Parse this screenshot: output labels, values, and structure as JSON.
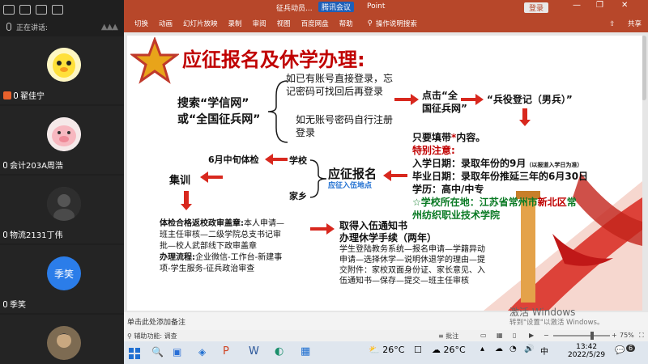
{
  "sidebar": {
    "speaking_label": "正在讲话:",
    "participants": [
      {
        "name": "翟佳宁",
        "avatar_type": "duck"
      },
      {
        "name": "会计203A周浩",
        "avatar_type": "pig"
      },
      {
        "name": "物流2131丁伟",
        "avatar_type": "photo"
      },
      {
        "name": "季笑",
        "avatar_text": "季笑"
      },
      {
        "name": "",
        "avatar_type": "photo"
      }
    ]
  },
  "titlebar": {
    "title": "征兵动员...",
    "meeting_label": "腾讯会议",
    "app_suffix": "Point",
    "login_label": "登录"
  },
  "ribbon": {
    "tabs": [
      "切换",
      "动画",
      "幻灯片放映",
      "录制",
      "审阅",
      "视图",
      "百度网盘",
      "帮助"
    ],
    "search_label": "操作说明搜索",
    "share_label": "共享"
  },
  "slide": {
    "title": "应征报名及休学办理:",
    "has_account": "如已有账号直接登录，忘\n记密码可找回后再登录",
    "search_prompt": "搜索“学信网”\n或“全国征兵网”",
    "no_account": "如无账号密码自行注册\n登录",
    "click_site": "点击“全\n国征兵网”",
    "register": "“兵役登记（男兵）”",
    "fill_required_pre": "只要填带",
    "fill_required_star": "*",
    "fill_required_post": "内容。",
    "special_note": "特别注意:",
    "entry_date": "入学日期：录取年份的9月",
    "entry_date_note": "（以报道入学日为准）",
    "grad_date": "毕业日期：录取年份推延三年的6月30日",
    "education": "学历：高中/中专",
    "school_location_pre": "☆学校所在地：江苏省常州市",
    "school_location_hl": "新北区",
    "school_location_post": "常\n州纺织职业技术学院",
    "enlist_signup": "应征报名",
    "enlist_location": "应征入伍地点",
    "school": "学校",
    "hometown": "家乡",
    "june_check": "6月中旬体检",
    "training": "集训",
    "approval_title": "体检合格返校政审盖章:",
    "approval_body": "本人申请—\n班主任审核—二级学院总支书记审\n批—校人武部线下政审盖章",
    "process_title": "办理流程:",
    "process_body": "企业微信-工作台-新建事\n项-学生服务-征兵政治审查",
    "notice_title": "取得入伍通知书\n办理休学手续（两年）",
    "notice_body": "学生登陆教务系统—报名申请—学籍异动\n申请—选择休学—说明休退学的理由—提\n交附件：家校双面身份证、家长意见、入\n伍通知书—保存—提交—班主任审核"
  },
  "notes": {
    "placeholder": "单击此处添加备注"
  },
  "statusbar": {
    "accessibility": "辅助功能: 调查",
    "notes_btn": "批注",
    "zoom": "75%"
  },
  "taskbar": {
    "weather_temp": "26°C",
    "weather_temp2": "26°C",
    "time": "13:42",
    "date": "2022/5/29",
    "ime": "中",
    "notif_count": "6",
    "activation_title": "激活 Windows",
    "activation_sub": "转到\"设置\"以激活 Windows。"
  },
  "colors": {
    "ppt_red": "#b7472a",
    "slide_red": "#c00000",
    "blue": "#1f6fd1",
    "accent": "#e23a2f"
  }
}
